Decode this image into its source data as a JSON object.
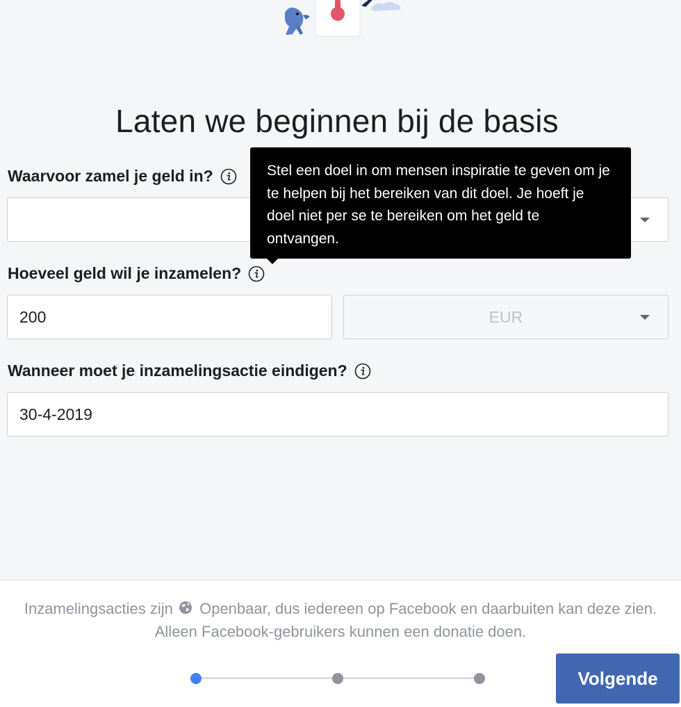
{
  "page": {
    "title": "Laten we beginnen bij de basis"
  },
  "form": {
    "category": {
      "label": "Waarvoor zamel je geld in?",
      "value": ""
    },
    "amount": {
      "label": "Hoeveel geld wil je inzamelen?",
      "value": "200",
      "currency": "EUR"
    },
    "end_date": {
      "label": "Wanneer moet je inzamelingsactie eindigen?",
      "value": "30-4-2019"
    }
  },
  "tooltip": {
    "text": "Stel een doel in om mensen inspiratie te geven om je te helpen bij het bereiken van dit doel. Je hoeft je doel niet per se te bereiken om het geld te ontvangen."
  },
  "footer": {
    "notice_before": "Inzamelingsacties zijn",
    "notice_after": "Openbaar, dus iedereen op Facebook en daarbuiten kan deze zien. Alleen Facebook-gebruikers kunnen een donatie doen.",
    "visibility_icon": "globe-icon",
    "next_label": "Volgende",
    "steps_total": 3,
    "current_step": 1
  },
  "colors": {
    "primary_button": "#4267b2",
    "active_step": "#4080ff",
    "inactive_step": "#90949c",
    "tooltip_bg": "#000000"
  }
}
